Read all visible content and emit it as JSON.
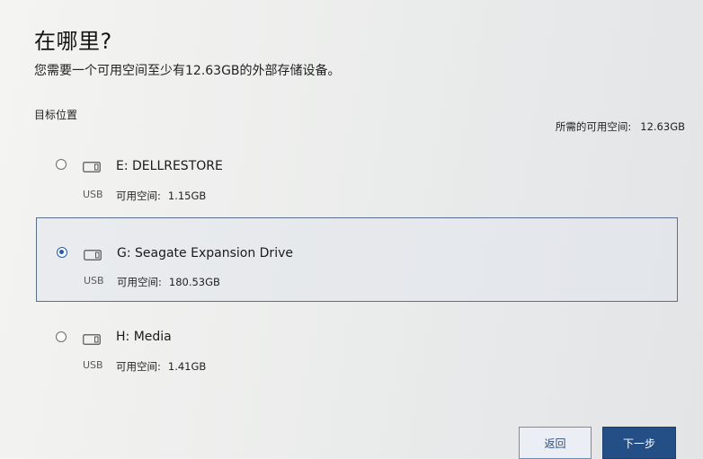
{
  "header": {
    "title": "在哪里?",
    "subtitle": "您需要一个可用空间至少有12.63GB的外部存储设备。"
  },
  "target": {
    "label": "目标位置",
    "required_label": "所需的可用空间:",
    "required_value": "12.63GB"
  },
  "drives": [
    {
      "name": "E: DELLRESTORE",
      "bus": "USB",
      "space_label": "可用空间:",
      "space_value": "1.15GB",
      "selected": false
    },
    {
      "name": "G: Seagate Expansion Drive",
      "bus": "USB",
      "space_label": "可用空间:",
      "space_value": "180.53GB",
      "selected": true
    },
    {
      "name": "H: Media",
      "bus": "USB",
      "space_label": "可用空间:",
      "space_value": "1.41GB",
      "selected": false
    }
  ],
  "buttons": {
    "back": "返回",
    "next": "下一步"
  },
  "colors": {
    "accent": "#234e86",
    "selected_border": "#5a6f8c"
  },
  "icons": {
    "drive": "external-drive-icon",
    "radio": "radio-button"
  }
}
